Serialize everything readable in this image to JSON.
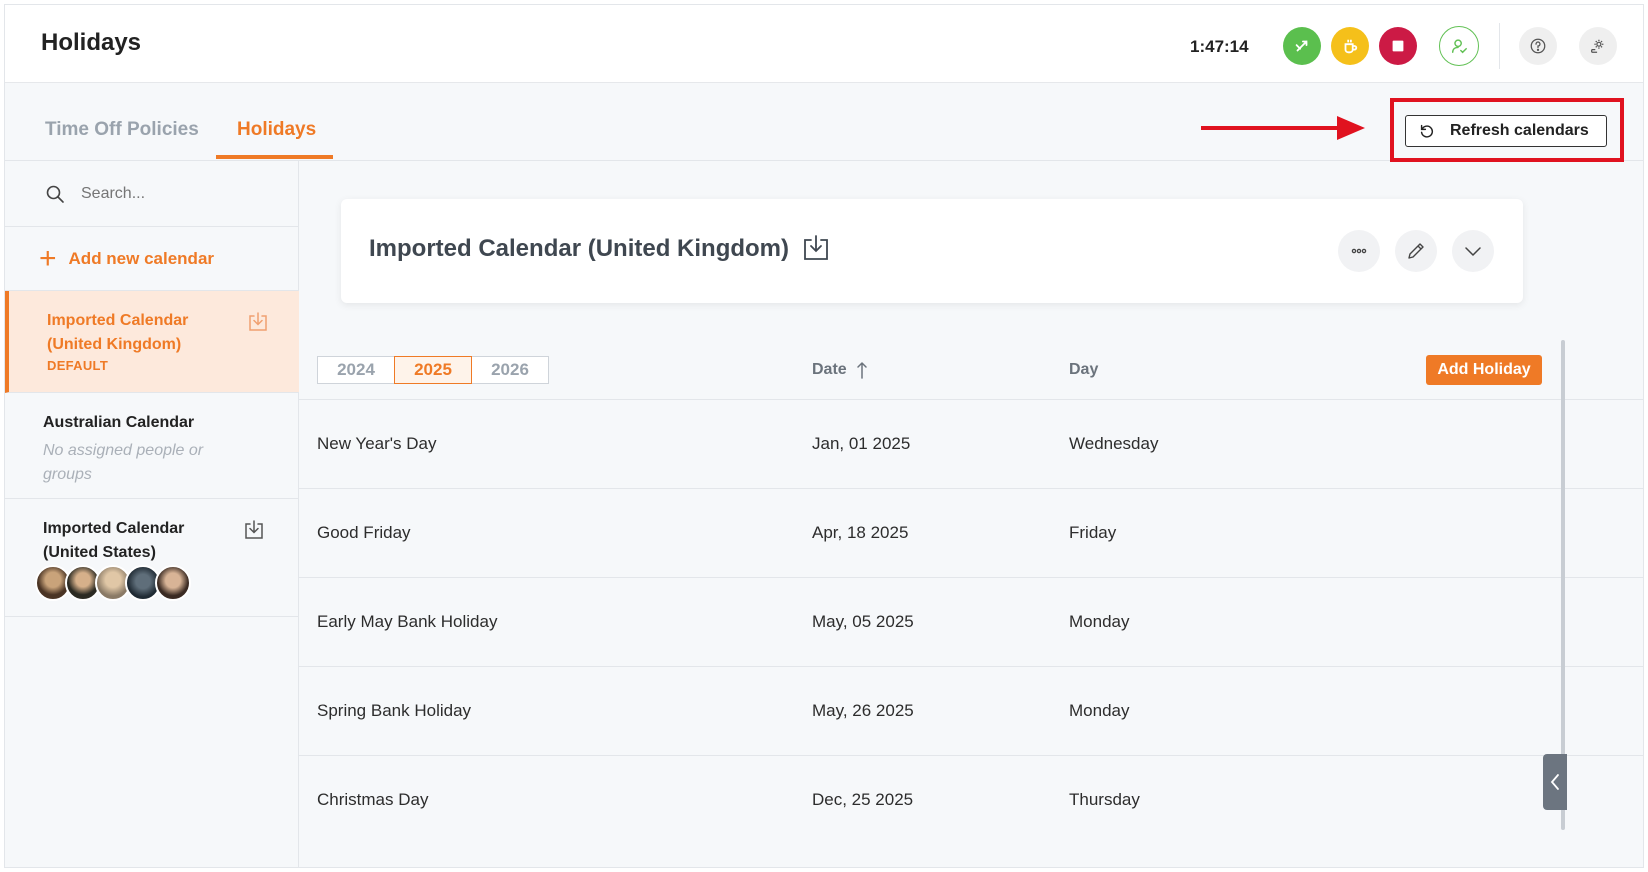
{
  "header": {
    "title": "Holidays",
    "timer": "1:47:14"
  },
  "tabs": [
    {
      "label": "Time Off Policies"
    },
    {
      "label": "Holidays"
    }
  ],
  "toolbar": {
    "refresh_label": "Refresh calendars"
  },
  "sidebar": {
    "search_placeholder": "Search...",
    "add_label": "Add new calendar",
    "calendars": [
      {
        "name": "Imported Calendar (United Kingdom)",
        "badge": "DEFAULT"
      },
      {
        "name": "Australian Calendar",
        "note": "No assigned people or groups"
      },
      {
        "name": "Imported Calendar (United States)"
      }
    ]
  },
  "main": {
    "calendar_title": "Imported Calendar (United Kingdom)",
    "years": [
      "2024",
      "2025",
      "2026"
    ],
    "selected_year": "2025",
    "columns": {
      "date": "Date",
      "day": "Day"
    },
    "add_holiday_label": "Add Holiday",
    "holidays": [
      {
        "name": "New Year's Day",
        "date": "Jan, 01 2025",
        "day": "Wednesday"
      },
      {
        "name": "Good Friday",
        "date": "Apr, 18 2025",
        "day": "Friday"
      },
      {
        "name": "Early May Bank Holiday",
        "date": "May, 05 2025",
        "day": "Monday"
      },
      {
        "name": "Spring Bank Holiday",
        "date": "May, 26 2025",
        "day": "Monday"
      },
      {
        "name": "Christmas Day",
        "date": "Dec, 25 2025",
        "day": "Thursday"
      }
    ]
  },
  "colors": {
    "accent": "#ef7a26",
    "annotation": "#e0121f",
    "timer_green": "#5bbf4e",
    "break_yellow": "#f5c01a",
    "stop_red": "#cc1a45"
  }
}
